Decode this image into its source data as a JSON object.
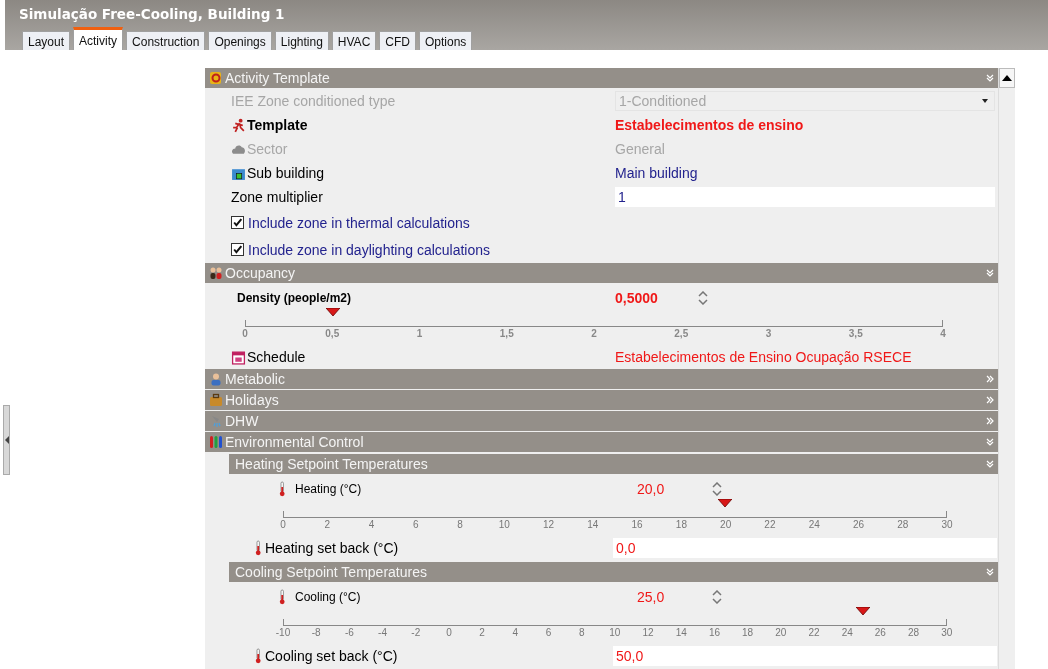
{
  "window": {
    "title": "Simulação Free-Cooling, Building 1"
  },
  "tabs": [
    {
      "label": "Layout",
      "selected": false
    },
    {
      "label": "Activity",
      "selected": true
    },
    {
      "label": "Construction",
      "selected": false
    },
    {
      "label": "Openings",
      "selected": false
    },
    {
      "label": "Lighting",
      "selected": false
    },
    {
      "label": "HVAC",
      "selected": false
    },
    {
      "label": "CFD",
      "selected": false
    },
    {
      "label": "Options",
      "selected": false
    }
  ],
  "sections": [
    {
      "kind": "activity",
      "title": "Activity Template",
      "expanded": true,
      "rows": [
        {
          "kind": "select",
          "label": "IEE Zone conditioned type",
          "value": "1-Conditioned",
          "disabled": true
        },
        {
          "kind": "template",
          "label": "Template",
          "value": "Estabelecimentos de ensino"
        },
        {
          "kind": "sector",
          "label": "Sector",
          "value": "General",
          "disabled": true
        },
        {
          "kind": "sub-building",
          "label": "Sub building",
          "value": "Main building"
        },
        {
          "kind": "input",
          "label": "Zone multiplier",
          "value": "1"
        },
        {
          "kind": "checkbox",
          "label": "Include zone in thermal calculations",
          "checked": true
        },
        {
          "kind": "checkbox",
          "label": "Include zone in daylighting calculations",
          "checked": true
        }
      ]
    },
    {
      "kind": "occupancy",
      "title": "Occupancy",
      "expanded": true,
      "rows": [
        {
          "kind": "slider",
          "label": "Density (people/m2)",
          "value": "0,5000",
          "level": 0.125,
          "ticks": [
            "0",
            "0,5",
            "1",
            "1,5",
            "2",
            "2,5",
            "3",
            "3,5",
            "4"
          ]
        },
        {
          "kind": "schedule",
          "label": "Schedule",
          "value": "Estabelecimentos de Ensino Ocupação RSECE"
        }
      ]
    },
    {
      "kind": "metabolic",
      "title": "Metabolic",
      "expanded": false
    },
    {
      "kind": "holidays",
      "title": "Holidays",
      "expanded": false
    },
    {
      "kind": "dhw",
      "title": "DHW",
      "expanded": false
    },
    {
      "kind": "environmental",
      "title": "Environmental Control",
      "expanded": true,
      "subsections": [
        {
          "title": "Heating Setpoint Temperatures",
          "expanded": true,
          "rows": [
            {
              "kind": "temp-slider",
              "label": "Heating (°C)",
              "value": "20,0",
              "level": 0.6667,
              "ticks": [
                "0",
                "2",
                "4",
                "6",
                "8",
                "10",
                "12",
                "14",
                "16",
                "18",
                "20",
                "22",
                "24",
                "26",
                "28",
                "30"
              ]
            },
            {
              "kind": "temp-input",
              "label": "Heating set back (°C)",
              "value": "0,0"
            }
          ]
        },
        {
          "title": "Cooling Setpoint Temperatures",
          "expanded": true,
          "rows": [
            {
              "kind": "temp-slider",
              "label": "Cooling (°C)",
              "value": "25,0",
              "level": 0.875,
              "ticks": [
                "-10",
                "-8",
                "-6",
                "-4",
                "-2",
                "0",
                "2",
                "4",
                "6",
                "8",
                "10",
                "12",
                "14",
                "16",
                "18",
                "20",
                "22",
                "24",
                "26",
                "28",
                "30"
              ]
            },
            {
              "kind": "temp-input",
              "label": "Cooling set back (°C)",
              "value": "50,0"
            }
          ]
        }
      ]
    }
  ]
}
